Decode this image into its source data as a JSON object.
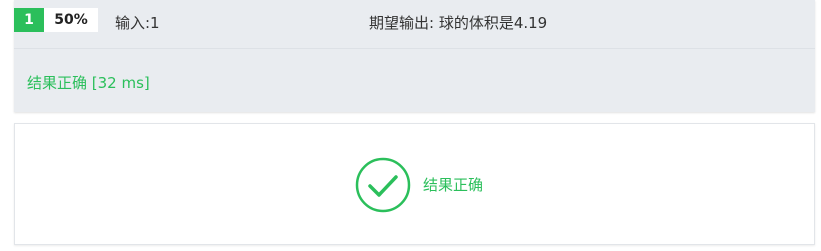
{
  "test_case": {
    "index": "1",
    "score": "50%",
    "input_label": "输入:1",
    "expected_label": "期望输出: 球的体积是4.19",
    "result_text": "结果正确 [32 ms]"
  },
  "summary": {
    "icon": "check-circle-icon",
    "result_text": "结果正确"
  },
  "colors": {
    "success": "#2bbf5b",
    "panel_bg": "#e9ecf0",
    "text": "#333333"
  }
}
